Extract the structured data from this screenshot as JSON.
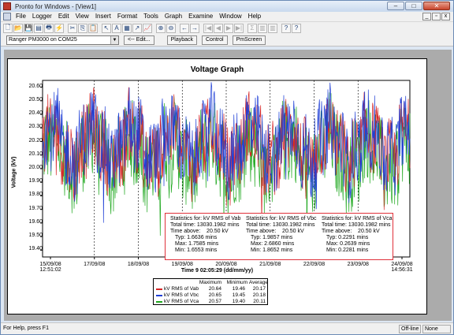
{
  "window": {
    "title": "Pronto for Windows - [View1]"
  },
  "window_buttons": {
    "min": "–",
    "max": "□",
    "close": "✕"
  },
  "mdi_buttons": {
    "min": "_",
    "restore": "▫",
    "close": "x"
  },
  "menu": [
    "File",
    "Logger",
    "Edit",
    "View",
    "Insert",
    "Format",
    "Tools",
    "Graph",
    "Examine",
    "Window",
    "Help"
  ],
  "toolbar": {
    "icons": [
      "new-doc-icon",
      "open-folder-icon",
      "save-icon",
      "save-all-icon",
      "print-icon",
      "connect-icon",
      "cut-icon",
      "copy-icon",
      "paste-icon",
      "pointer-icon",
      "text-tool-icon",
      "table-icon",
      "line-tool-icon",
      "graph-icon",
      "zoom-in-icon",
      "zoom-out-icon",
      "back-arrow-icon",
      "forward-arrow-icon",
      "first-icon",
      "prev-icon",
      "next-icon",
      "last-icon",
      "sum-icon",
      "calc-icon",
      "calc2-icon",
      "help-pointer-icon",
      "context-help-icon"
    ],
    "glyphs": [
      "🗋",
      "📂",
      "💾",
      "▤",
      "🖶",
      "⚡",
      "✂",
      "⎘",
      "📋",
      "↖",
      "A",
      "▦",
      "↗",
      "📈",
      "⊕",
      "⊖",
      "←",
      "→",
      "|◀",
      "◀",
      "▶",
      "▶|",
      "Σ",
      "▥",
      "▥",
      "?",
      "?"
    ]
  },
  "toolbar2": {
    "logger_select": "Ranger PM3000 on COM25",
    "edit_button": "<-- Edit...",
    "playback_button": "Playback",
    "control_button": "Control",
    "pmscreen_button": "PmScreen"
  },
  "status": {
    "left": "For Help, press F1",
    "connection": "Off-line",
    "mode": "None"
  },
  "chart_data": {
    "type": "line",
    "title": "Voltage Graph",
    "ylabel": "Voltage (kV)",
    "xlabel": "Time 9 02:05:29 (dd/mm/yy)",
    "ylim": [
      19.35,
      20.65
    ],
    "yticks": [
      "20.60",
      "20.50",
      "20.40",
      "20.30",
      "20.20",
      "20.10",
      "20.00",
      "19.90",
      "19.80",
      "19.70",
      "19.60",
      "19.50",
      "19.40"
    ],
    "xticks": [
      {
        "l1": "15/09/08",
        "l2": "12:51:02"
      },
      {
        "l1": "17/09/08",
        "l2": ""
      },
      {
        "l1": "18/09/08",
        "l2": ""
      },
      {
        "l1": "19/09/08",
        "l2": ""
      },
      {
        "l1": "20/09/08",
        "l2": ""
      },
      {
        "l1": "21/09/08",
        "l2": ""
      },
      {
        "l1": "22/09/08",
        "l2": ""
      },
      {
        "l1": "23/09/08",
        "l2": ""
      },
      {
        "l1": "24/09/08",
        "l2": "14:56:31"
      }
    ],
    "series": [
      {
        "name": "kV RMS of Vab",
        "color": "#d62728",
        "max": "20.64",
        "min": "19.46",
        "avg": "20.17"
      },
      {
        "name": "kV RMS of Vbc",
        "color": "#1f3fd6",
        "max": "20.65",
        "min": "19.45",
        "avg": "20.18"
      },
      {
        "name": "kV RMS of Vca",
        "color": "#1fa81f",
        "max": "20.57",
        "min": "19.40",
        "avg": "20.11"
      }
    ],
    "legend_headers": {
      "max": "Maximum",
      "min": "Minimum",
      "avg": "Average"
    },
    "statistics": [
      {
        "header": "Statistics for: kV RMS of Vab",
        "total": "Total time: 13030.1982 mins",
        "above": "Time above:",
        "thr": "20.50 kV",
        "typ": "Typ: 1.6636 mins",
        "max": "Max: 1.7585 mins",
        "min": "Min: 1.6553 mins"
      },
      {
        "header": "Statistics for: kV RMS of Vbc",
        "total": "Total time: 13030.1982 mins",
        "above": "Time above:",
        "thr": "20.50 kV",
        "typ": "Typ: 1.9857 mins",
        "max": "Max: 2.6860 mins",
        "min": "Min: 1.8652 mins"
      },
      {
        "header": "Statistics for: kV RMS of Vca",
        "total": "Total time: 13030.1982 mins",
        "above": "Time above:",
        "thr": "20.50 kV",
        "typ": "Typ: 0.2291 mins",
        "max": "Max: 0.2639 mins",
        "min": "Min: 0.2281 mins"
      }
    ]
  }
}
